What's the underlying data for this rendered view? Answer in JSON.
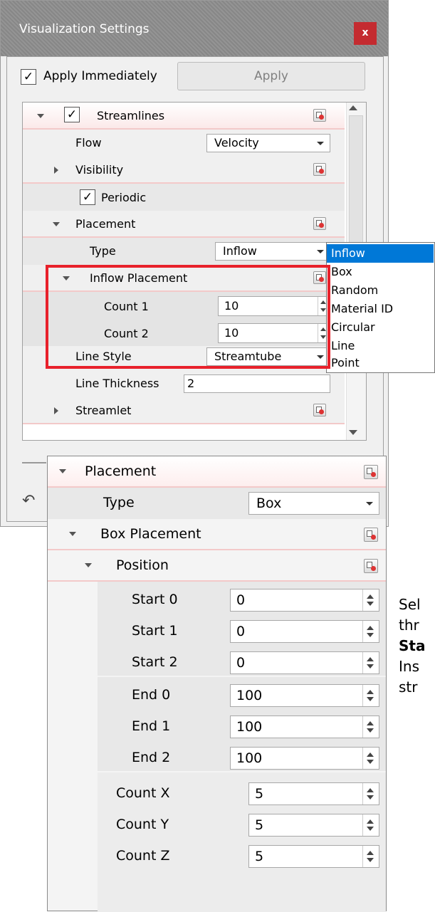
{
  "dialog": {
    "title": "Visualization Settings",
    "close_label": "x",
    "apply_immediately_label": "Apply Immediately",
    "apply_immediately_checked": true,
    "apply_button_label": "Apply"
  },
  "tree": {
    "streamlines_label": "Streamlines",
    "flow_label": "Flow",
    "flow_value": "Velocity",
    "visibility_label": "Visibility",
    "periodic_label": "Periodic",
    "placement_label": "Placement",
    "type_label": "Type",
    "type_value": "Inflow",
    "inflow_placement_label": "Inflow Placement",
    "count1_label": "Count 1",
    "count1_value": "10",
    "count2_label": "Count 2",
    "count2_value": "10",
    "line_style_label": "Line Style",
    "line_style_value": "Streamtube",
    "line_thickness_label": "Line Thickness",
    "line_thickness_value": "2",
    "streamlet_label": "Streamlet"
  },
  "type_dropdown": {
    "options": [
      "Inflow",
      "Box",
      "Random",
      "Material ID",
      "Circular",
      "Line",
      "Point"
    ],
    "selected": "Inflow"
  },
  "panel2": {
    "placement_label": "Placement",
    "type_label": "Type",
    "type_value": "Box",
    "box_placement_label": "Box Placement",
    "position_label": "Position",
    "start0_label": "Start 0",
    "start0_value": "0",
    "start1_label": "Start 1",
    "start1_value": "0",
    "start2_label": "Start 2",
    "start2_value": "0",
    "end0_label": "End 0",
    "end0_value": "100",
    "end1_label": "End 1",
    "end1_value": "100",
    "end2_label": "End 2",
    "end2_value": "100",
    "countx_label": "Count X",
    "countx_value": "5",
    "county_label": "Count Y",
    "county_value": "5",
    "countz_label": "Count Z",
    "countz_value": "5"
  },
  "side_text": {
    "line1": "Sel",
    "line2": "thr",
    "line3": "Sta",
    "line4": "Ins",
    "line5": "str"
  },
  "colors": {
    "title_bar": "#8c8c8c",
    "close_button": "#c42b30",
    "highlight_box": "#e8212b",
    "dropdown_selection": "#0078d7",
    "header_underline": "#f3c9c9"
  }
}
